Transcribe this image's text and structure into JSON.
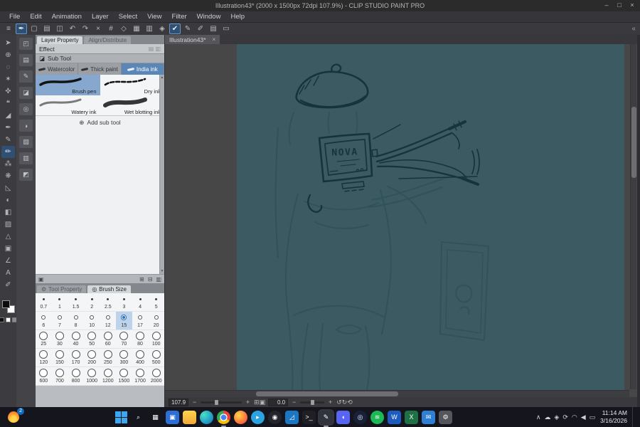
{
  "titlebar": {
    "title": "Illustration43* (2000 x 1500px 72dpi 107.9%) - CLIP STUDIO PAINT PRO",
    "controls": [
      {
        "name": "minimize-button",
        "glyph": "–"
      },
      {
        "name": "maximize-button",
        "glyph": "□"
      },
      {
        "name": "close-button",
        "glyph": "×"
      }
    ]
  },
  "menubar": {
    "items": [
      "File",
      "Edit",
      "Animation",
      "Layer",
      "Select",
      "View",
      "Filter",
      "Window",
      "Help"
    ]
  },
  "toolbar": {
    "icons": [
      {
        "name": "main-menu-icon",
        "glyph": "≡"
      },
      {
        "name": "object-tool-icon",
        "glyph": "✒",
        "active": true
      },
      {
        "name": "new-canvas-icon",
        "glyph": "▢"
      },
      {
        "name": "open-file-icon",
        "glyph": "▤"
      },
      {
        "name": "save-file-icon",
        "glyph": "◫"
      },
      {
        "name": "undo-icon",
        "glyph": "↶"
      },
      {
        "name": "redo-icon",
        "glyph": "↷"
      },
      {
        "name": "delete-icon",
        "glyph": "×"
      },
      {
        "name": "snap-to-ruler-icon",
        "glyph": "#"
      },
      {
        "name": "snap-to-special-ruler-icon",
        "glyph": "◇"
      },
      {
        "name": "snap-to-grid-icon",
        "glyph": "▦"
      },
      {
        "name": "show-grid-icon",
        "glyph": "▥"
      },
      {
        "name": "symmetry-icon",
        "glyph": "◈"
      },
      {
        "name": "correct-line-icon",
        "glyph": "✔",
        "active": true
      },
      {
        "name": "pen-pressure-icon",
        "glyph": "✎"
      },
      {
        "name": "vector-snap-icon",
        "glyph": "✐"
      },
      {
        "name": "material-panel-icon",
        "glyph": "▤"
      },
      {
        "name": "workspace-panel-icon",
        "glyph": "▭"
      }
    ],
    "overflow_icon": "«"
  },
  "tools": {
    "items": [
      {
        "name": "operation-tool",
        "glyph": "➤"
      },
      {
        "name": "zoom-tool",
        "glyph": "⊕"
      },
      {
        "name": "lasso-tool",
        "glyph": "◌"
      },
      {
        "name": "auto-select-tool",
        "glyph": "✶"
      },
      {
        "name": "move-tool",
        "glyph": "✜"
      },
      {
        "name": "balloon-tool",
        "glyph": "❝"
      },
      {
        "name": "eyedropper-tool",
        "glyph": "◢"
      },
      {
        "name": "pen-tool",
        "glyph": "✒"
      },
      {
        "name": "pencil-tool",
        "glyph": "✎"
      },
      {
        "name": "brush-tool",
        "glyph": "✏",
        "active": true
      },
      {
        "name": "airbrush-tool",
        "glyph": "⁂"
      },
      {
        "name": "decoration-tool",
        "glyph": "❋"
      },
      {
        "name": "eraser-tool",
        "glyph": "◺"
      },
      {
        "name": "blend-tool",
        "glyph": "◐"
      },
      {
        "name": "fill-tool",
        "glyph": "◧"
      },
      {
        "name": "gradient-tool",
        "glyph": "▨"
      },
      {
        "name": "figure-tool",
        "glyph": "△"
      },
      {
        "name": "frame-border-tool",
        "glyph": "▣"
      },
      {
        "name": "ruler-tool",
        "glyph": "∠"
      },
      {
        "name": "text-tool",
        "glyph": "A"
      },
      {
        "name": "line-correction-tool",
        "glyph": "✐"
      }
    ]
  },
  "dock": {
    "icons": [
      {
        "name": "dock-quick-access-icon",
        "glyph": "◰"
      },
      {
        "name": "dock-material-icon",
        "glyph": "▤"
      },
      {
        "name": "dock-sub-tool-icon",
        "glyph": "✎"
      },
      {
        "name": "dock-tool-property-icon",
        "glyph": "◪"
      },
      {
        "name": "dock-brush-size-icon",
        "glyph": "◎"
      },
      {
        "name": "dock-color-wheel-icon",
        "glyph": "◑"
      },
      {
        "name": "dock-layer-icon",
        "glyph": "▧"
      },
      {
        "name": "dock-navigator-icon",
        "glyph": "▥"
      },
      {
        "name": "dock-history-icon",
        "glyph": "◩"
      }
    ]
  },
  "panels": {
    "layer_property": {
      "tab_active": "Layer Property",
      "tab_inactive": "Align/Distribute",
      "effect_label": "Effect",
      "effect_icons": "▤ ▥"
    },
    "sub_tool": {
      "header_icon": "◪",
      "title": "Sub Tool",
      "tabs": [
        "Watercolor",
        "Thick paint",
        "India ink"
      ],
      "active_tab": "India ink",
      "brushes": [
        "Brush pen",
        "Dry ink",
        "Watery ink",
        "Wet blotting ink"
      ],
      "selected_brush": "Brush pen",
      "add_icon": "⊕",
      "add_label": "Add sub tool",
      "footer_icons": [
        {
          "name": "lock-palette-icon",
          "glyph": "▣"
        },
        {
          "name": "new-subtool-button",
          "glyph": "⊞"
        },
        {
          "name": "duplicate-subtool-button",
          "glyph": "⊟"
        },
        {
          "name": "delete-subtool-button",
          "glyph": "▥"
        }
      ],
      "scroll_up_icon": "▲",
      "scroll_down_icon": "▼"
    },
    "brush_size": {
      "tabs": [
        {
          "label": "Tool Property",
          "icon": "⚙",
          "active": false
        },
        {
          "label": "Brush Size",
          "icon": "◎",
          "active": true
        }
      ],
      "sizes": [
        "0.7",
        "1",
        "1.5",
        "2",
        "2.5",
        "3",
        "4",
        "5",
        "6",
        "7",
        "8",
        "10",
        "12",
        "15",
        "17",
        "20",
        "25",
        "30",
        "40",
        "50",
        "60",
        "70",
        "80",
        "100",
        "120",
        "150",
        "170",
        "200",
        "250",
        "300",
        "400",
        "500",
        "600",
        "700",
        "800",
        "1000",
        "1200",
        "1500",
        "1700",
        "2000"
      ],
      "selected_size": "15"
    }
  },
  "canvas": {
    "tab_label": "Illustration43*",
    "tab_close_icon": "×",
    "monitor_text": "NOVA",
    "background_color": "#3b5a61",
    "line_color": "#17333e",
    "accent_color": "#5b87b7"
  },
  "statusbar": {
    "zoom": "107.9",
    "rotation": "0.0",
    "minus_icon": "−",
    "plus_icon": "+",
    "zoom_icons": [
      {
        "name": "fit-to-screen-button",
        "glyph": "⊞"
      },
      {
        "name": "actual-pixels-button",
        "glyph": "▣"
      }
    ],
    "rotation_icons": [
      {
        "name": "rotate-left-button",
        "glyph": "↺"
      },
      {
        "name": "rotate-right-button",
        "glyph": "↻"
      },
      {
        "name": "reset-view-button",
        "glyph": "⟲"
      }
    ]
  },
  "taskbar": {
    "badge": "2",
    "time": "11:14 AM",
    "date": "3/16/2026",
    "apps": [
      {
        "name": "start-button",
        "kind": "win"
      },
      {
        "name": "search-button",
        "glyph": "⌕"
      },
      {
        "name": "task-view-button",
        "glyph": "▦"
      },
      {
        "name": "widgets-app",
        "bg": "#2e6fd6",
        "glyph": "▣"
      },
      {
        "name": "file-explorer",
        "bg": "linear-gradient(#ffd34d,#f0a93a)"
      },
      {
        "name": "edge-browser",
        "bg": "radial-gradient(circle at 30% 30%,#49e0c8,#0a6fc2)",
        "circle": true
      },
      {
        "name": "chrome-browser",
        "bg": "radial-gradient(circle,#4285f4 0 28%,#fff 29% 38%,transparent 39%),conic-gradient(#ea4335 0 33%,#fbbc05 0 66%,#34a853 0 100%)",
        "circle": true,
        "running": true
      },
      {
        "name": "firefox-browser",
        "bg": "radial-gradient(circle at 35% 35%,#ffd54a,#ff7139 62%,#c43b85)",
        "circle": true
      },
      {
        "name": "telegram-app",
        "bg": "#2ba3e0",
        "circle": true,
        "glyph": "▸"
      },
      {
        "name": "obs-studio",
        "bg": "#23252d",
        "circle": true,
        "glyph": "◉"
      },
      {
        "name": "vs-code",
        "bg": "#1c77c3",
        "glyph": "◿"
      },
      {
        "name": "terminal-app",
        "bg": "#1f1f24",
        "glyph": ">_"
      },
      {
        "name": "clip-studio-paint",
        "bg": "#30343c",
        "glyph": "✎",
        "running": true,
        "active": true
      },
      {
        "name": "discord-app",
        "bg": "#5865f2",
        "glyph": "◖"
      },
      {
        "name": "steam-app",
        "bg": "#17213a",
        "circle": true,
        "glyph": "◎"
      },
      {
        "name": "spotify-app",
        "bg": "#1db954",
        "circle": true,
        "glyph": "≋"
      },
      {
        "name": "word-app",
        "bg": "#1d5bbf",
        "glyph": "W"
      },
      {
        "name": "excel-app",
        "bg": "#1e7145",
        "glyph": "X"
      },
      {
        "name": "mail-app",
        "bg": "#2f7fd4",
        "glyph": "✉"
      },
      {
        "name": "settings-app",
        "bg": "#55565c",
        "glyph": "⚙"
      }
    ],
    "tray": [
      {
        "name": "tray-expand-icon",
        "glyph": "∧"
      },
      {
        "name": "onedrive-icon",
        "glyph": "☁"
      },
      {
        "name": "security-icon",
        "glyph": "◈"
      },
      {
        "name": "update-icon",
        "glyph": "⟳"
      },
      {
        "name": "wifi-icon",
        "glyph": "◠"
      },
      {
        "name": "volume-icon",
        "glyph": "◀"
      },
      {
        "name": "battery-icon",
        "glyph": "▭"
      }
    ]
  }
}
